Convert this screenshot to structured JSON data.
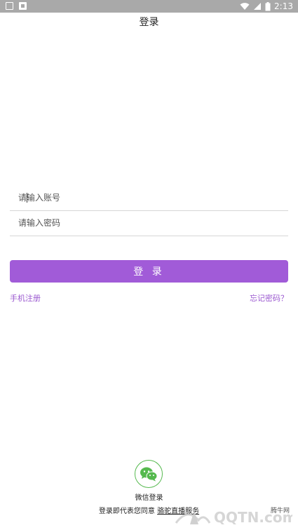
{
  "status_bar": {
    "time": "2:13",
    "icons": [
      "notification-box-icon",
      "notification-filled-box-icon",
      "wifi-icon",
      "signal-icon",
      "battery-icon"
    ]
  },
  "header": {
    "title": "登录"
  },
  "form": {
    "account_placeholder": "请输入账号",
    "password_placeholder": "请输入密码",
    "login_label": "登 录"
  },
  "links": {
    "register": "手机注册",
    "forgot_password": "忘记密码？"
  },
  "wechat": {
    "label": "微信登录",
    "icon": "wechat-icon"
  },
  "agreement": {
    "prefix": "登录即代表您同意",
    "terms": "骆驼直播服务"
  },
  "watermark": {
    "logo_text": "QQTN.com",
    "site_label": "腾牛网"
  },
  "colors": {
    "accent": "#a15bd8",
    "link": "#9b59d0",
    "wechat_green": "#55b94e",
    "status_bar": "#a9a9a9"
  }
}
